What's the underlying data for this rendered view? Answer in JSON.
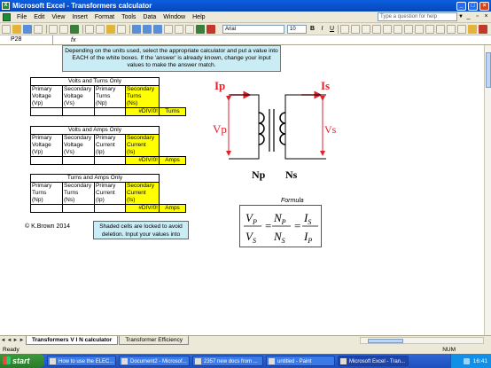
{
  "window": {
    "title": "Microsoft Excel - Transformers calculator"
  },
  "menu": {
    "items": [
      "File",
      "Edit",
      "View",
      "Insert",
      "Format",
      "Tools",
      "Data",
      "Window",
      "Help"
    ],
    "help_placeholder": "Type a question for help"
  },
  "toolbar": {
    "font": "Arial",
    "size": "10"
  },
  "formula_bar": {
    "cell_ref": "P28",
    "fx": "fx"
  },
  "sheet": {
    "instruction": "Depending on the units used, select the appropriate calculator and put a value into EACH of the white boxes. If the 'answer' is already known, change your input values to make the answer match.",
    "tables": [
      {
        "title": "Volts and Turns Only",
        "headers": [
          [
            "Primary",
            "Voltage",
            "(Vp)"
          ],
          [
            "Secondary",
            "Voltage",
            "(Vs)"
          ],
          [
            "Primary",
            "Turns",
            "(Np)"
          ],
          [
            "Secondary",
            "Turns",
            "(Ns)"
          ]
        ],
        "result": "#DIV/0!",
        "unit": "Turns"
      },
      {
        "title": "Volts and Amps Only",
        "headers": [
          [
            "Primary",
            "Voltage",
            "(Vp)"
          ],
          [
            "Secondary",
            "Voltage",
            "(Vs)"
          ],
          [
            "Primary",
            "Current",
            "(Ip)"
          ],
          [
            "Secondary",
            "Current",
            "(Is)"
          ]
        ],
        "result": "#DIV/0!",
        "unit": "Amps"
      },
      {
        "title": "Turns and Amps Only",
        "headers": [
          [
            "Primary",
            "Turns",
            "(Np)"
          ],
          [
            "Secondary",
            "Turns",
            "(Ns)"
          ],
          [
            "Primary",
            "Current",
            "(Ip)"
          ],
          [
            "Secondary",
            "Current",
            "(Is)"
          ]
        ],
        "result": "#DIV/0!",
        "unit": "Amps"
      }
    ],
    "copyright": "© K.Brown 2014",
    "note": "Shaded cells are locked to avoid deletion. Input your values into",
    "diagram": {
      "ip": "Ip",
      "is": "Is",
      "vp": "Vp",
      "vs": "Vs",
      "np": "Np",
      "ns": "Ns"
    },
    "formula_label": "Formula",
    "formula": {
      "vp": "V",
      "vp_sub": "P",
      "vs": "V",
      "vs_sub": "S",
      "np": "N",
      "np_sub": "P",
      "ns": "N",
      "ns_sub": "S",
      "is": "I",
      "is_sub": "S",
      "ip": "I",
      "ip_sub": "P"
    }
  },
  "tabs": [
    "Transformers V I N calculator",
    "Transformer Efficiency"
  ],
  "status": {
    "left": "Ready",
    "num": "NUM"
  },
  "taskbar": {
    "start": "start",
    "tasks": [
      "How to use the ELEC...",
      "Document2 - Microsof...",
      "2357 new docs from ...",
      "untitled - Paint",
      "Microsoft Excel - Tran..."
    ],
    "clock": "16:41"
  },
  "colors": {
    "highlight": "#ffff00",
    "info_box": "#c9ecf5",
    "arrow": "#e0202a"
  }
}
